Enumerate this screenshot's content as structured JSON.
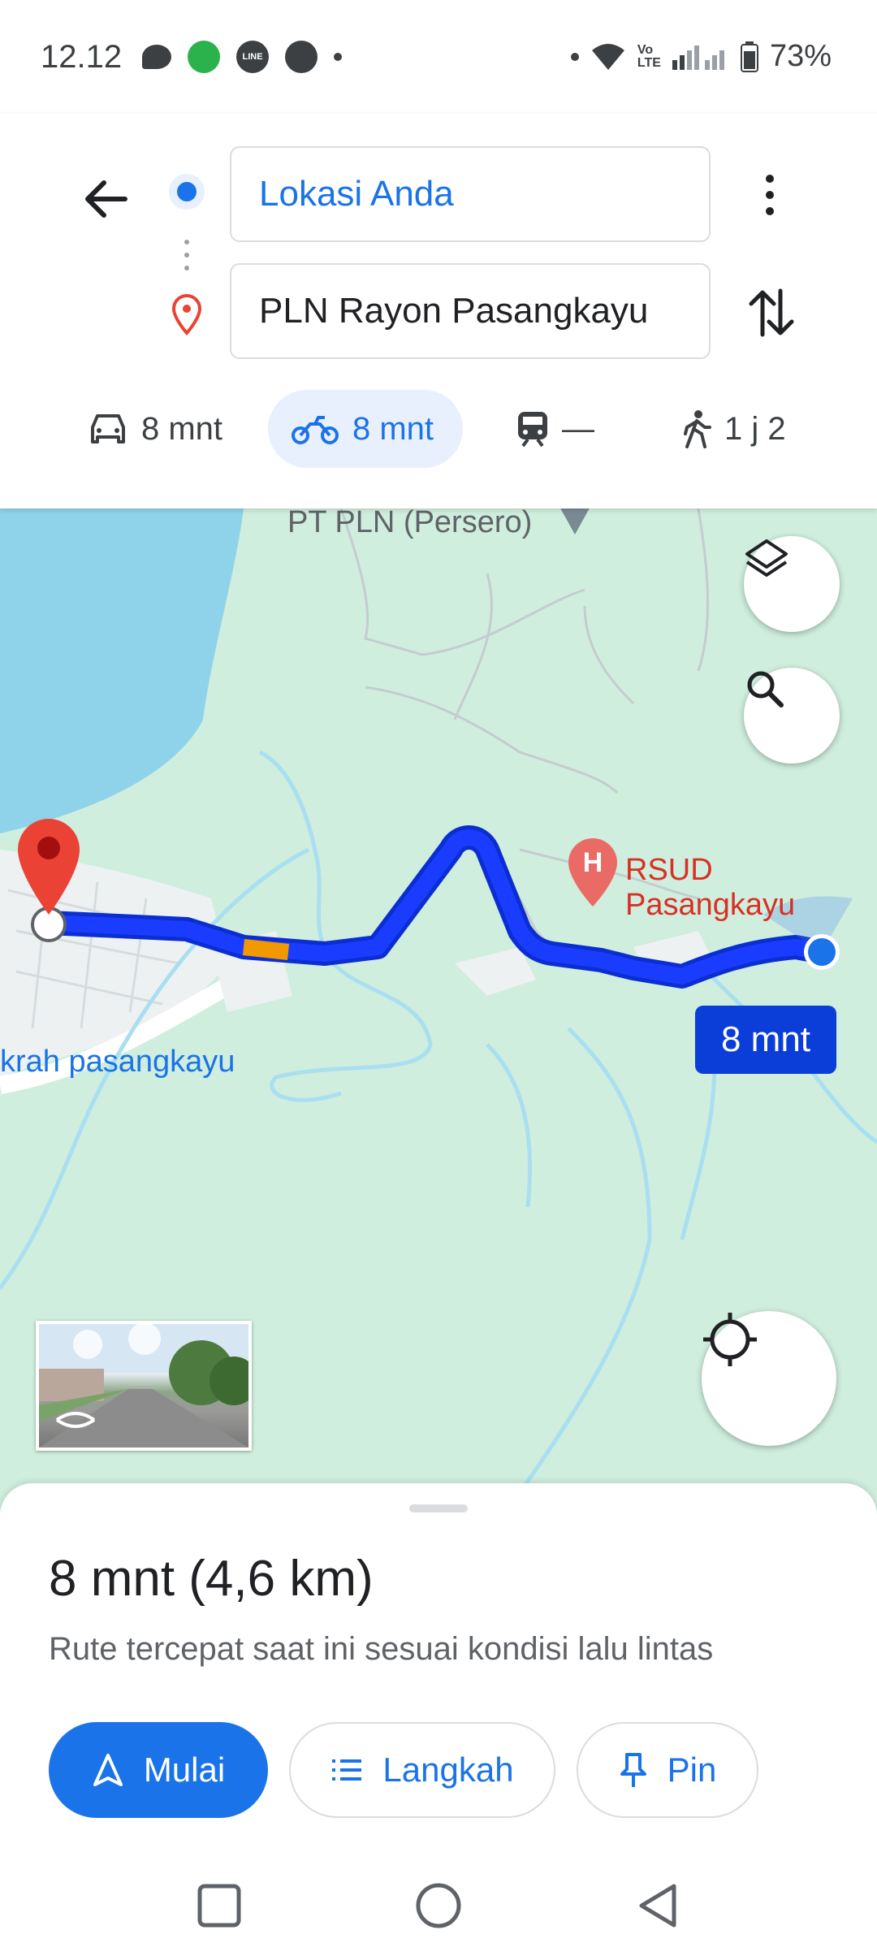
{
  "status_bar": {
    "time": "12.12",
    "battery": "73%"
  },
  "directions": {
    "origin": "Lokasi Anda",
    "destination": "PLN Rayon Pasangkayu"
  },
  "modes": [
    {
      "name": "car",
      "label": "8 mnt",
      "active": false
    },
    {
      "name": "motorcycle",
      "label": "8 mnt",
      "active": true
    },
    {
      "name": "transit",
      "label": "—",
      "active": false
    },
    {
      "name": "walk",
      "label": "1 j 2",
      "active": false
    }
  ],
  "map": {
    "label_top": "PT PLN (Persero)",
    "label_hospital": "RSUD Pasangkayu",
    "label_left": "krah pasangkayu",
    "eta_badge": "8 mnt",
    "colors": {
      "route": "#1a3cff",
      "water": "#8fd3ea",
      "land": "#cfeede",
      "marker": "#ea4335"
    }
  },
  "sheet": {
    "title": "8 mnt (4,6 km)",
    "subtitle": "Rute tercepat saat ini sesuai kondisi lalu lintas",
    "start_label": "Mulai",
    "steps_label": "Langkah",
    "pin_label": "Pin"
  }
}
